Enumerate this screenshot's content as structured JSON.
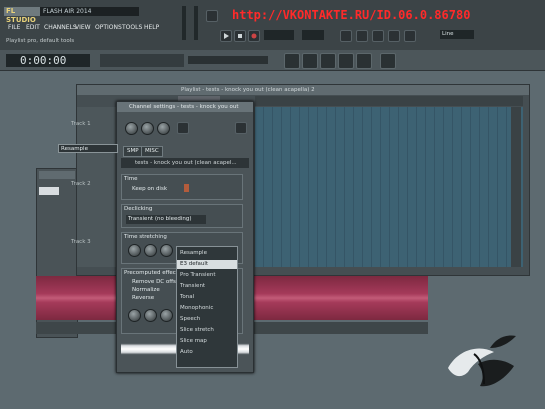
{
  "header": {
    "logo": "FL STUDIO",
    "song_title": "FLASH AIR 2014",
    "menu": [
      "FILE",
      "EDIT",
      "CHANNELS",
      "VIEW",
      "OPTIONS",
      "TOOLS",
      "HELP"
    ],
    "hint": "Playlist pro, default tools",
    "overlay_url": "http://VKONTAKTE.RU/ID.06.0.86780"
  },
  "transport": {
    "time": "0:00:00",
    "preset_field": "Line"
  },
  "playlist": {
    "title": "Playlist - tests - knock you out (clean acapella) 2",
    "tracks": [
      "Track 1",
      "Track 2",
      "Track 3"
    ]
  },
  "channel": {
    "title": "Channel settings - tests - knock you out",
    "tabs": [
      "SMP",
      "MISC"
    ],
    "name": "tests - knock you out (clean acapel...",
    "sections": {
      "time": "Time",
      "keep_on_disk": "Keep on disk",
      "declicking": "Declicking",
      "declick_mode": "Transient (no bleeding)",
      "time_stretching": "Time stretching",
      "precomputed": "Precomputed effect",
      "effects": [
        "Remove DC offset",
        "Normalize",
        "Reverse"
      ]
    },
    "stretch_mode": "Resample"
  },
  "dropdown": {
    "items": [
      "Resample",
      "E3 default",
      "Pro Transient",
      "Transient",
      "Tonal",
      "Monophonic",
      "Speech",
      "Slice stretch",
      "Slice map",
      "Auto"
    ],
    "selected_index": 1
  },
  "colors": {
    "accent_red": "#ff2a2a",
    "selection": "#a53a5a",
    "grid": "#3d6273"
  }
}
